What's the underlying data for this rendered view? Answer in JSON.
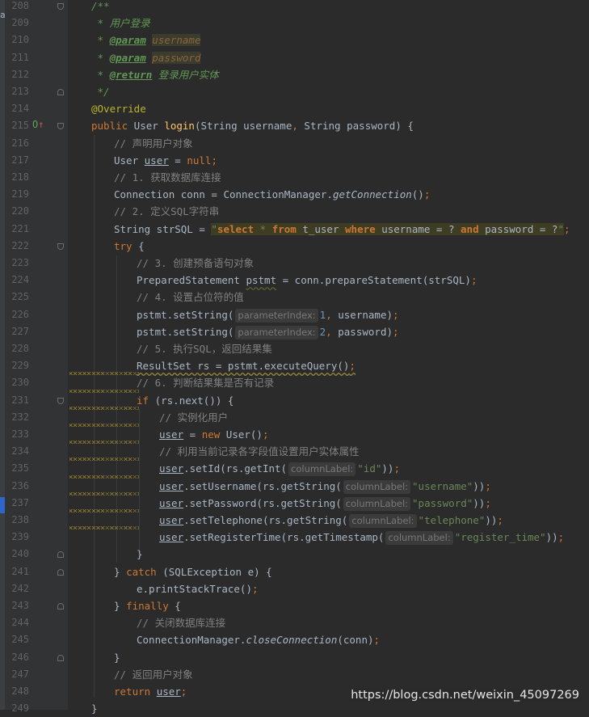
{
  "editor": {
    "left_glyph": "a",
    "watermark": "https://blog.csdn.net/weixin_45097269",
    "colors": {
      "background": "#2b2b2b",
      "gutter": "#313335",
      "keyword": "#cc7832",
      "string": "#6a8759",
      "comment": "#808080",
      "doc": "#629755",
      "method": "#ffc66d"
    },
    "lines": [
      {
        "n": "208",
        "t": "/**"
      },
      {
        "n": "209",
        "t": " * 用户登录"
      },
      {
        "n": "210",
        "t": " * @param username"
      },
      {
        "n": "211",
        "t": " * @param password"
      },
      {
        "n": "212",
        "t": " * @return 登录用户实体"
      },
      {
        "n": "213",
        "t": " */"
      },
      {
        "n": "214",
        "t": "@Override"
      },
      {
        "n": "215",
        "t": "public User login(String username, String password) {"
      },
      {
        "n": "216",
        "t": "// 声明用户对象"
      },
      {
        "n": "217",
        "t": "User user = null;"
      },
      {
        "n": "218",
        "t": "// 1. 获取数据库连接"
      },
      {
        "n": "219",
        "t": "Connection conn = ConnectionManager.getConnection();"
      },
      {
        "n": "220",
        "t": "// 2. 定义SQL字符串"
      },
      {
        "n": "221",
        "t": "String strSQL = \"select * from t_user where username = ? and password = ?\";"
      },
      {
        "n": "222",
        "t": "try {"
      },
      {
        "n": "223",
        "t": "// 3. 创建预备语句对象"
      },
      {
        "n": "224",
        "t": "PreparedStatement pstmt = conn.prepareStatement(strSQL);"
      },
      {
        "n": "225",
        "t": "// 4. 设置占位符的值"
      },
      {
        "n": "226",
        "t": "pstmt.setString( parameterIndex: 1, username);"
      },
      {
        "n": "227",
        "t": "pstmt.setString( parameterIndex: 2, password);"
      },
      {
        "n": "228",
        "t": "// 5. 执行SQL，返回结果集"
      },
      {
        "n": "229",
        "t": "ResultSet rs = pstmt.executeQuery();"
      },
      {
        "n": "230",
        "t": "// 6. 判断结果集是否有记录"
      },
      {
        "n": "231",
        "t": "if (rs.next()) {"
      },
      {
        "n": "232",
        "t": "// 实例化用户"
      },
      {
        "n": "233",
        "t": "user = new User();"
      },
      {
        "n": "234",
        "t": "// 利用当前记录各字段值设置用户实体属性"
      },
      {
        "n": "235",
        "t": "user.setId(rs.getInt( columnLabel: \"id\"));"
      },
      {
        "n": "236",
        "t": "user.setUsername(rs.getString( columnLabel: \"username\"));"
      },
      {
        "n": "237",
        "t": "user.setPassword(rs.getString( columnLabel: \"password\"));"
      },
      {
        "n": "238",
        "t": "user.setTelephone(rs.getString( columnLabel: \"telephone\"));"
      },
      {
        "n": "239",
        "t": "user.setRegisterTime(rs.getTimestamp( columnLabel: \"register_time\"));"
      },
      {
        "n": "240",
        "t": "}"
      },
      {
        "n": "241",
        "t": "} catch (SQLException e) {"
      },
      {
        "n": "242",
        "t": "e.printStackTrace();"
      },
      {
        "n": "243",
        "t": "} finally {"
      },
      {
        "n": "244",
        "t": "// 关闭数据库连接"
      },
      {
        "n": "245",
        "t": "ConnectionManager.closeConnection(conn);"
      },
      {
        "n": "246",
        "t": "}"
      },
      {
        "n": "247",
        "t": "// 返回用户对象"
      },
      {
        "n": "248",
        "t": "return user;"
      },
      {
        "n": "249",
        "t": "}"
      }
    ]
  }
}
